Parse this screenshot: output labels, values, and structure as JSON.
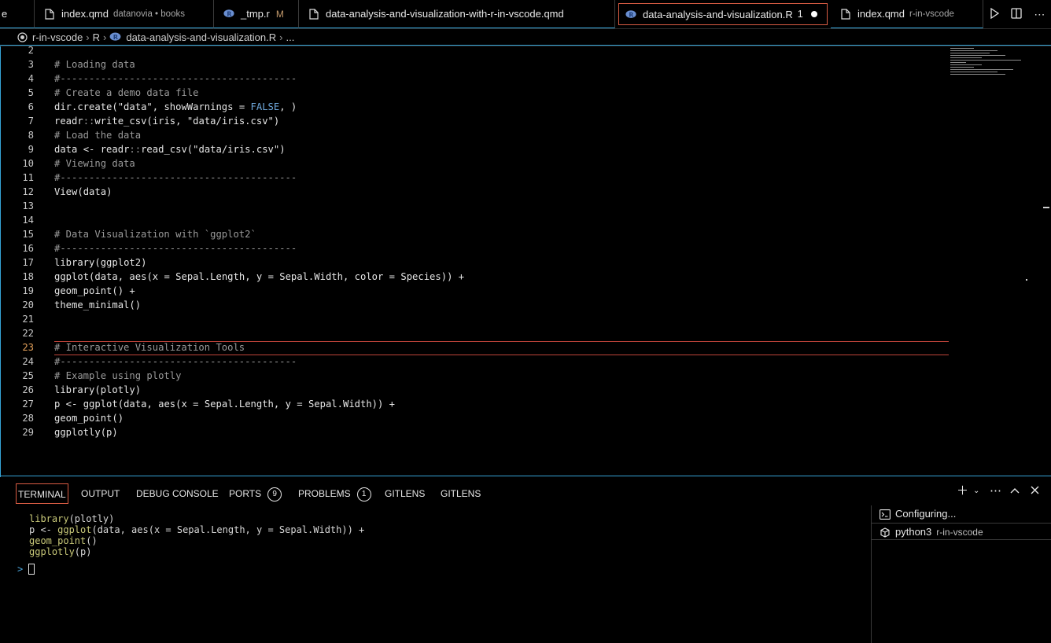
{
  "tabs": [
    {
      "name": "e",
      "desc": "",
      "flag": ""
    },
    {
      "name": "index.qmd",
      "desc": "datanovia • books",
      "flag": ""
    },
    {
      "name": "_tmp.r",
      "desc": "",
      "flag": "M"
    },
    {
      "name": "data-analysis-and-visualization-with-r-in-vscode.qmd",
      "desc": "",
      "flag": ""
    },
    {
      "name": "data-analysis-and-visualization.R",
      "desc": "",
      "flag": "1"
    },
    {
      "name": "index.qmd",
      "desc": "r-in-vscode",
      "flag": ""
    }
  ],
  "breadcrumb": {
    "folder": "r-in-vscode",
    "subfolder": "R",
    "file": "data-analysis-and-visualization.R",
    "more": "..."
  },
  "editor": {
    "lines": [
      {
        "n": "2",
        "t": ""
      },
      {
        "n": "3",
        "t": "# Loading data"
      },
      {
        "n": "4",
        "t": "#-----------------------------------------"
      },
      {
        "n": "5",
        "t": "# Create a demo data file"
      },
      {
        "n": "6",
        "t": "dir.create(\"data\", showWarnings = FALSE, )"
      },
      {
        "n": "7",
        "t": "readr::write_csv(iris, \"data/iris.csv\")"
      },
      {
        "n": "8",
        "t": "# Load the data"
      },
      {
        "n": "9",
        "t": "data <- readr::read_csv(\"data/iris.csv\")"
      },
      {
        "n": "10",
        "t": "# Viewing data"
      },
      {
        "n": "11",
        "t": "#-----------------------------------------"
      },
      {
        "n": "12",
        "t": "View(data)"
      },
      {
        "n": "13",
        "t": ""
      },
      {
        "n": "14",
        "t": ""
      },
      {
        "n": "15",
        "t": "# Data Visualization with `ggplot2`"
      },
      {
        "n": "16",
        "t": "#-----------------------------------------"
      },
      {
        "n": "17",
        "t": "library(ggplot2)"
      },
      {
        "n": "18",
        "t": "ggplot(data, aes(x = Sepal.Length, y = Sepal.Width, color = Species)) +"
      },
      {
        "n": "19",
        "t": "geom_point() +"
      },
      {
        "n": "20",
        "t": "theme_minimal()"
      },
      {
        "n": "21",
        "t": ""
      },
      {
        "n": "22",
        "t": ""
      },
      {
        "n": "23",
        "t": "# Interactive Visualization Tools"
      },
      {
        "n": "24",
        "t": "#-----------------------------------------"
      },
      {
        "n": "25",
        "t": "# Example using plotly"
      },
      {
        "n": "26",
        "t": "library(plotly)"
      },
      {
        "n": "27",
        "t": "p <- ggplot(data, aes(x = Sepal.Length, y = Sepal.Width)) +"
      },
      {
        "n": "28",
        "t": "geom_point()"
      },
      {
        "n": "29",
        "t": "ggplotly(p)"
      }
    ],
    "current_line": "23"
  },
  "panel": {
    "tabs": [
      "TERMINAL",
      "OUTPUT",
      "DEBUG CONSOLE",
      "PORTS",
      "PROBLEMS",
      "GITLENS",
      "GITLENS"
    ],
    "ports_count": "9",
    "problems_count": "1"
  },
  "terminal": {
    "lines": [
      "library(plotly)",
      "p <- ggplot(data, aes(x = Sepal.Length, y = Sepal.Width)) +",
      "geom_point()",
      "ggplotly(p)"
    ],
    "prompt": ">"
  },
  "terminal_list": [
    {
      "name": "Configuring...",
      "desc": ""
    },
    {
      "name": "python3",
      "desc": "r-in-vscode"
    }
  ],
  "colors": {
    "accent_blue": "#35a3d6",
    "active_border": "#d95c43",
    "current_line_border": "#c0443a",
    "line_number_current": "#e3a05a"
  }
}
